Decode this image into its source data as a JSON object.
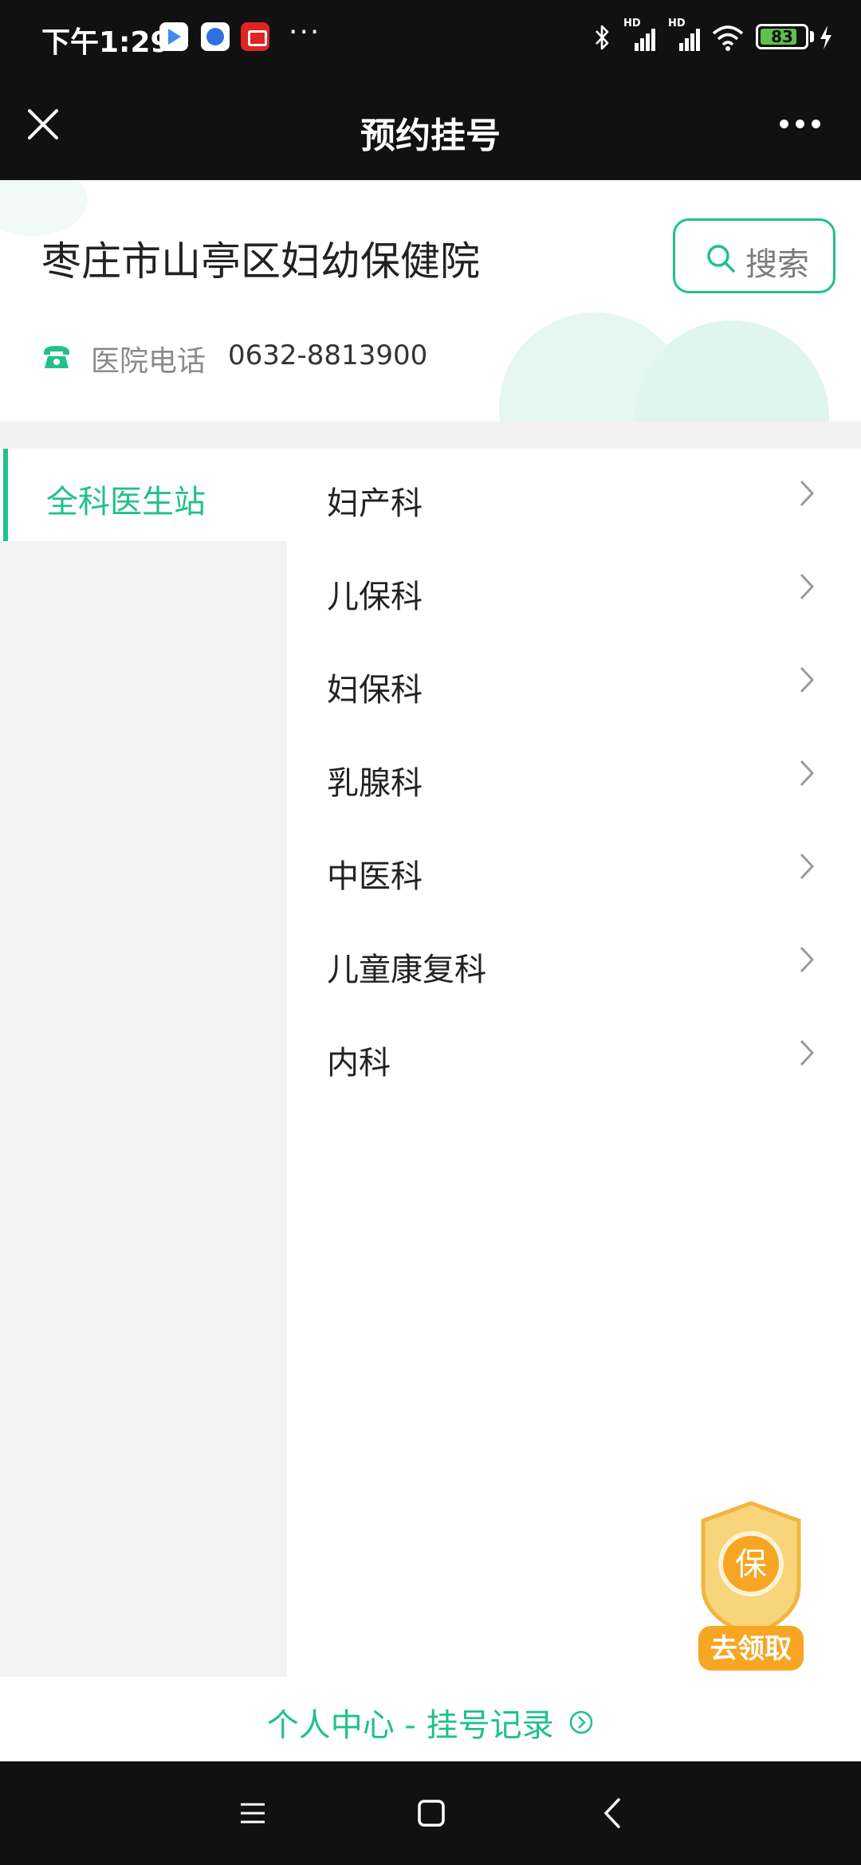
{
  "status_bar": {
    "time": "下午1:29",
    "dots": "···",
    "signal_label": "HD",
    "battery_level": "83",
    "battery_fraction": 0.83
  },
  "title_bar": {
    "title": "预约挂号"
  },
  "hospital": {
    "name": "枣庄市山亭区妇幼保健院",
    "search_label": "搜索",
    "phone_label": "医院电话",
    "phone_number": "0632-8813900"
  },
  "sidebar": {
    "items": [
      {
        "label": "全科医生站",
        "selected": true
      }
    ]
  },
  "departments": [
    {
      "label": "妇产科"
    },
    {
      "label": "儿保科"
    },
    {
      "label": "妇保科"
    },
    {
      "label": "乳腺科"
    },
    {
      "label": "中医科"
    },
    {
      "label": "儿童康复科"
    },
    {
      "label": "内科"
    }
  ],
  "promo_badge": {
    "char": "保",
    "label": "去领取"
  },
  "footer": {
    "link_label": "个人中心 - 挂号记录"
  },
  "colors": {
    "accent": "#20c08c",
    "dark_bar": "#111111",
    "badge_orange": "#f6a623"
  }
}
